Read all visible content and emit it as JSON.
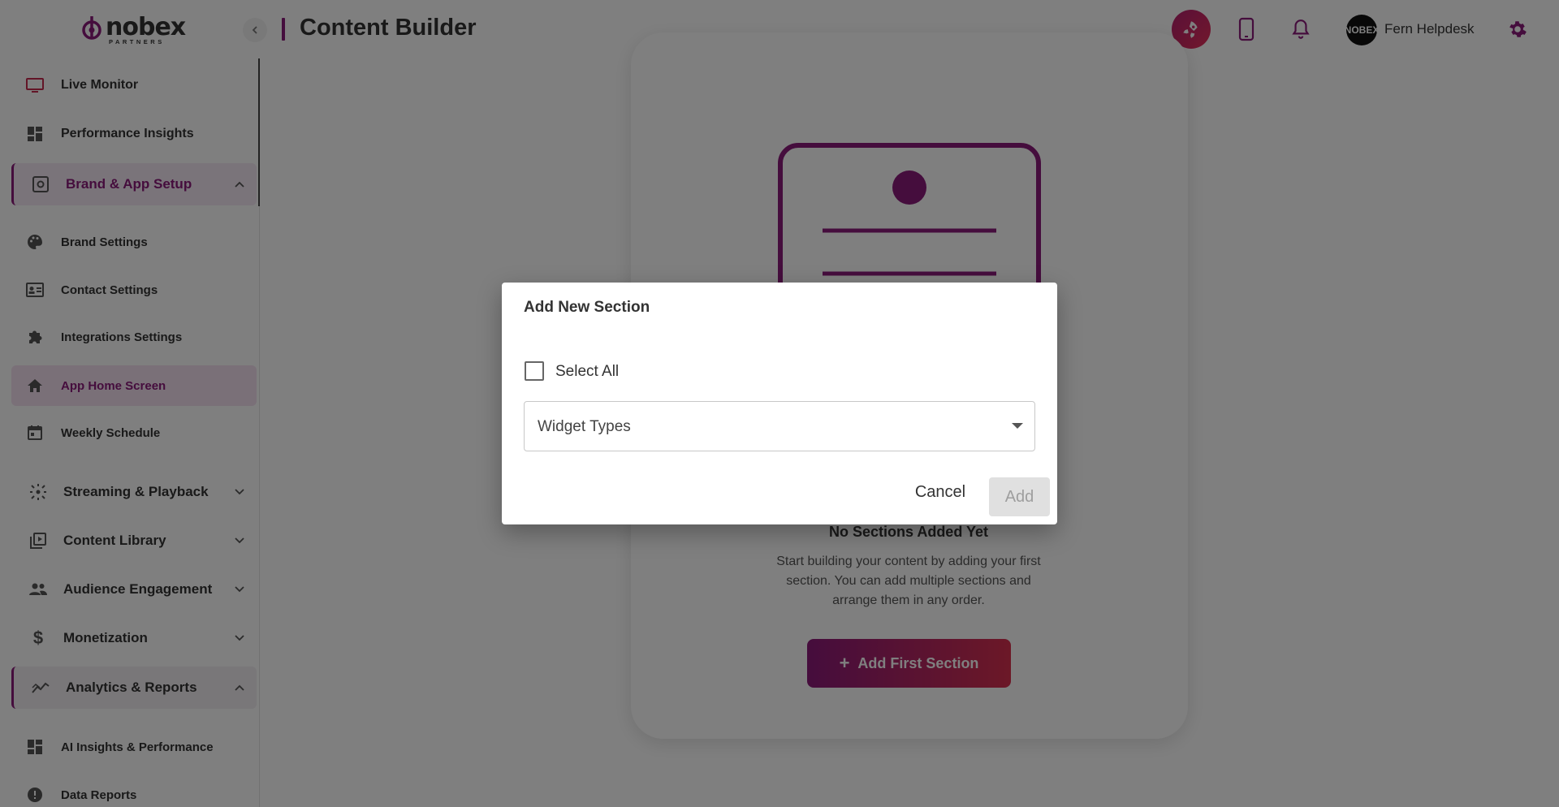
{
  "app": {
    "logo_text": "nobex",
    "logo_sub": "PARTNERS",
    "page_title": "Content Builder"
  },
  "user": {
    "avatar_text": "NOBEX",
    "name": "Fern Helpdesk"
  },
  "sidebar": {
    "items": [
      {
        "label": "Live Monitor",
        "icon": "monitor-icon"
      },
      {
        "label": "Performance Insights",
        "icon": "dashboard-icon"
      },
      {
        "label": "Brand & App Setup",
        "icon": "settings-box-icon",
        "expanded": true
      },
      {
        "label": "Brand Settings",
        "icon": "palette-icon"
      },
      {
        "label": "Contact Settings",
        "icon": "contact-card-icon"
      },
      {
        "label": "Integrations Settings",
        "icon": "puzzle-icon"
      },
      {
        "label": "App Home Screen",
        "icon": "home-icon",
        "active": true
      },
      {
        "label": "Weekly Schedule",
        "icon": "calendar-icon"
      },
      {
        "label": "Streaming & Playback",
        "icon": "broadcast-icon"
      },
      {
        "label": "Content Library",
        "icon": "library-icon"
      },
      {
        "label": "Audience Engagement",
        "icon": "people-icon"
      },
      {
        "label": "Monetization",
        "icon": "dollar-icon"
      },
      {
        "label": "Analytics & Reports",
        "icon": "analytics-icon",
        "expanded": true
      },
      {
        "label": "AI Insights & Performance",
        "icon": "dashboard-icon"
      },
      {
        "label": "Data Reports",
        "icon": "info-icon"
      }
    ]
  },
  "main": {
    "empty_title": "No Sections Added Yet",
    "empty_desc": "Start building your content by adding your first section. You can add multiple sections and arrange them in any order.",
    "add_first_label": "Add First Section"
  },
  "modal": {
    "title": "Add New Section",
    "select_all_label": "Select All",
    "widget_types_placeholder": "Widget Types",
    "cancel_label": "Cancel",
    "add_label": "Add"
  },
  "colors": {
    "brand": "#8b1a7a",
    "accent": "#d8304f",
    "overlay": "rgba(0,0,0,0.5)"
  }
}
